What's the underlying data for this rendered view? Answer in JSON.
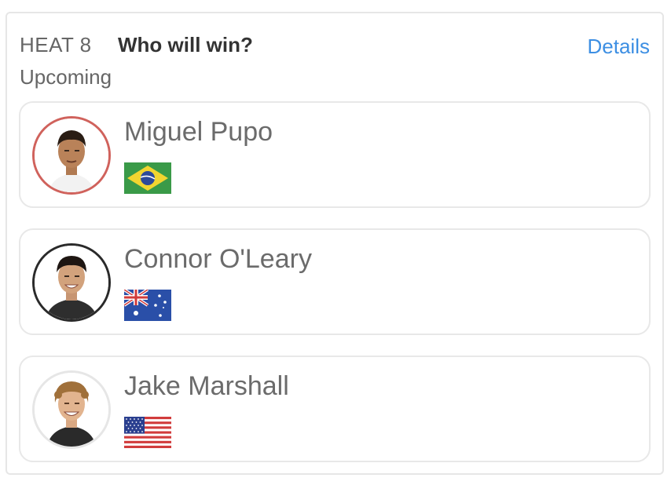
{
  "header": {
    "heat_label": "HEAT 8",
    "question": "Who will win?",
    "details_label": "Details",
    "status": "Upcoming"
  },
  "colors": {
    "accent_link": "#3d8fe3",
    "favorite_ring": "#d0625c",
    "selected_ring": "#2a2a2a",
    "default_ring": "#e6e6e6"
  },
  "surfers": [
    {
      "name": "Miguel Pupo",
      "flag": "brazil-flag",
      "ring": "favorite"
    },
    {
      "name": "Connor O'Leary",
      "flag": "australia-flag",
      "ring": "selected"
    },
    {
      "name": "Jake Marshall",
      "flag": "usa-flag",
      "ring": "default"
    }
  ]
}
